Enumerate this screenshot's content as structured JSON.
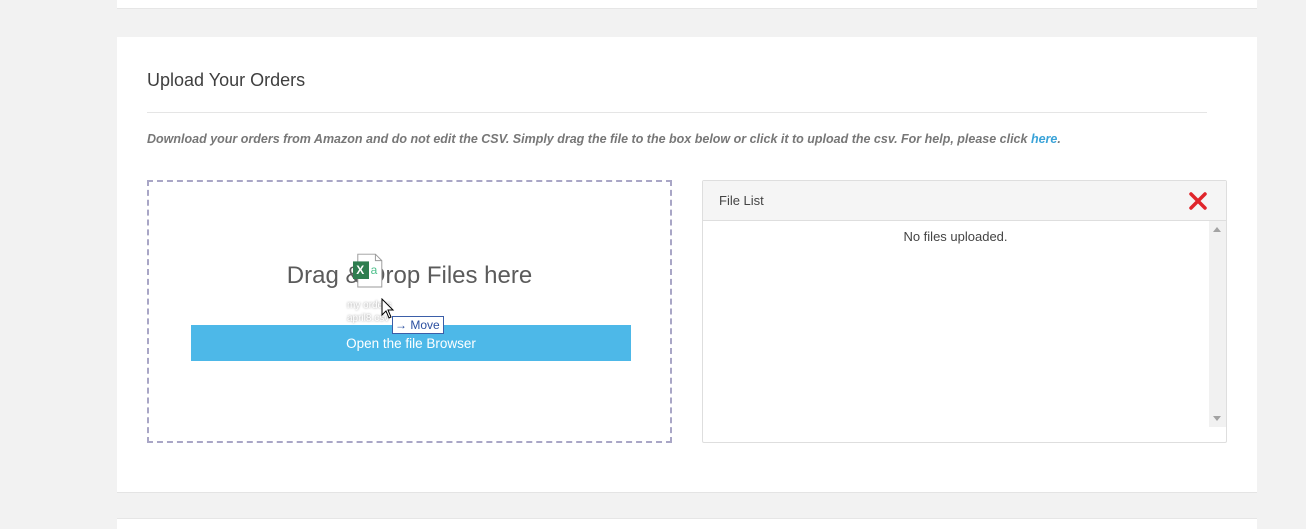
{
  "section": {
    "title": "Upload Your Orders",
    "instructions": {
      "text": "Download your orders from Amazon and do not edit the CSV. Simply drag the file to the box below or click it to upload the csv. For help, please click ",
      "link_text": "here",
      "trailing": "."
    }
  },
  "dropzone": {
    "prompt": "Drag & Drop Files here",
    "browse_label": "Open the file Browser"
  },
  "drag_ghost": {
    "file_name_line1": "my orders",
    "file_name_line2": "april8.csv",
    "tooltip": "Move",
    "icon": "excel-csv-icon"
  },
  "file_list": {
    "title": "File List",
    "empty_message": "No files uploaded.",
    "close_icon": "close-icon"
  },
  "colors": {
    "accent": "#4db8e8",
    "link": "#3aa3d8",
    "close": "#e0252b",
    "dropzone_border": "#a9a6c6"
  }
}
